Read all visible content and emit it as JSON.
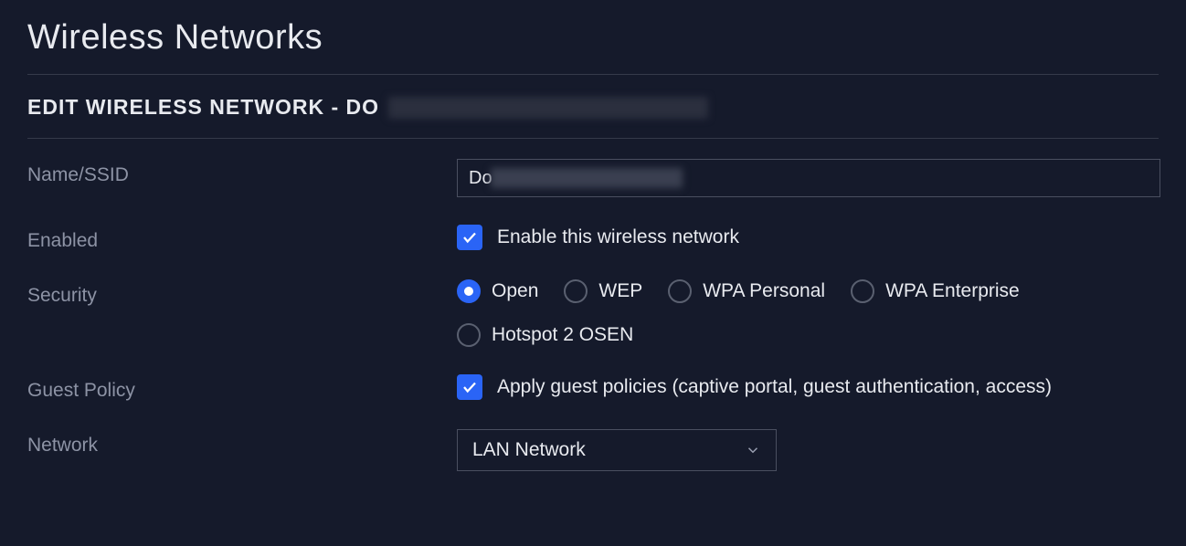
{
  "page": {
    "title": "Wireless Networks"
  },
  "section": {
    "prefix": "EDIT WIRELESS NETWORK - DO"
  },
  "form": {
    "name_ssid": {
      "label": "Name/SSID",
      "value_prefix": "Do"
    },
    "enabled": {
      "label": "Enabled",
      "checkbox_label": "Enable this wireless network",
      "checked": true
    },
    "security": {
      "label": "Security",
      "options": [
        {
          "label": "Open",
          "selected": true
        },
        {
          "label": "WEP",
          "selected": false
        },
        {
          "label": "WPA Personal",
          "selected": false
        },
        {
          "label": "WPA Enterprise",
          "selected": false
        },
        {
          "label": "Hotspot 2 OSEN",
          "selected": false
        }
      ]
    },
    "guest_policy": {
      "label": "Guest Policy",
      "checkbox_label": "Apply guest policies (captive portal, guest authentication, access)",
      "checked": true
    },
    "network": {
      "label": "Network",
      "selected": "LAN Network"
    }
  },
  "colors": {
    "accent": "#2a64f6",
    "bg": "#151a2b",
    "border": "#4a4f60",
    "text": "#e8eaef",
    "muted": "#8d93a5"
  }
}
